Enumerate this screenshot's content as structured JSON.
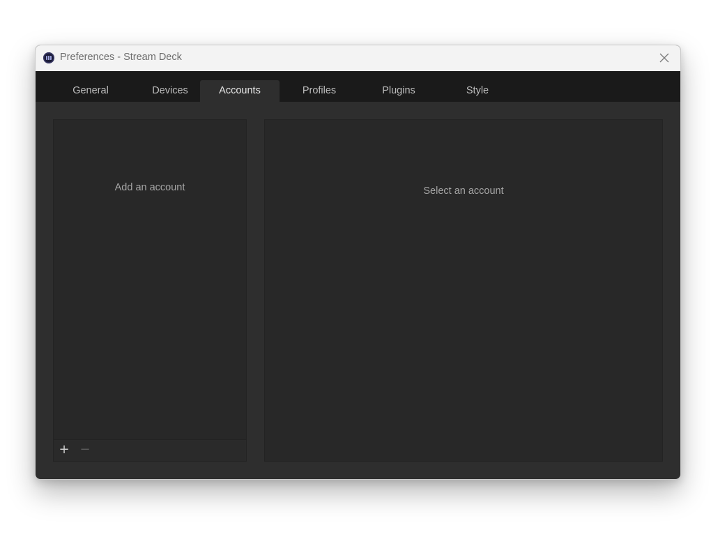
{
  "window": {
    "title": "Preferences - Stream Deck",
    "app_icon": "stream-deck-icon",
    "close_icon": "close-icon"
  },
  "tabs": [
    {
      "label": "General",
      "active": false
    },
    {
      "label": "Devices",
      "active": false
    },
    {
      "label": "Accounts",
      "active": true
    },
    {
      "label": "Profiles",
      "active": false
    },
    {
      "label": "Plugins",
      "active": false
    },
    {
      "label": "Style",
      "active": false
    }
  ],
  "accounts_list": {
    "empty_text": "Add an account",
    "add_label": "+",
    "remove_label": "−"
  },
  "account_details": {
    "empty_text": "Select an account"
  },
  "colors": {
    "window_bg": "#2e2e2e",
    "tabbar_bg": "#1a1a1a",
    "panel_bg": "#282828",
    "titlebar_bg": "#f3f3f3"
  }
}
